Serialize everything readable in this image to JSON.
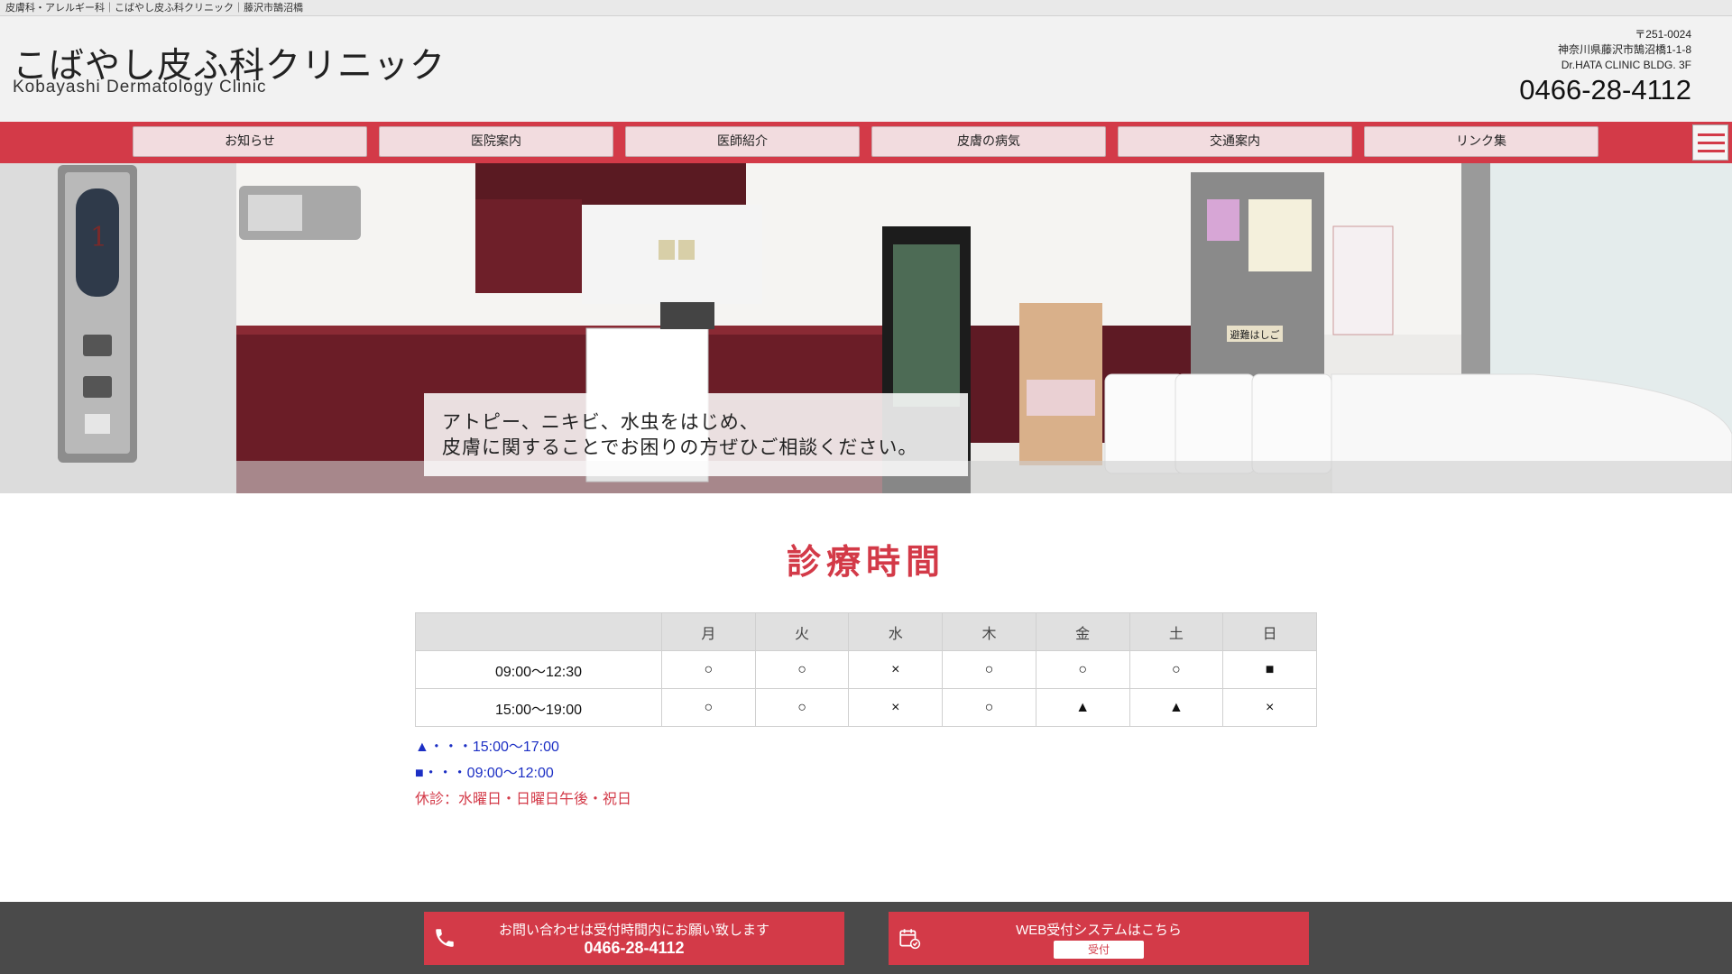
{
  "top_strip": {
    "text": "皮膚科・アレルギー科｜こばやし皮ふ科クリニック｜藤沢市鵠沼橋"
  },
  "header": {
    "logo_jp": "こばやし皮ふ科クリニック",
    "logo_en": "Kobayashi Dermatology Clinic",
    "postal": "〒251-0024",
    "address": "神奈川県藤沢市鵠沼橋1-1-8",
    "building": "Dr.HATA CLINIC BLDG. 3F",
    "tel": "0466-28-4112"
  },
  "nav": {
    "items": [
      "お知らせ",
      "医院案内",
      "医師紹介",
      "皮膚の病気",
      "交通案内",
      "リンク集"
    ],
    "menu_icon": "hamburger-icon"
  },
  "hero": {
    "caption_line1": "アトピー、ニキビ、水虫をはじめ、",
    "caption_line2": "皮膚に関することでお困りの方ぜひご相談ください。",
    "sign_text": "避難はしご"
  },
  "hours": {
    "title": "診療時間",
    "days": [
      "月",
      "火",
      "水",
      "木",
      "金",
      "土",
      "日"
    ],
    "rows": [
      {
        "time": "09:00～12:30",
        "cells": [
          "○",
          "○",
          "×",
          "○",
          "○",
          "○",
          "■"
        ]
      },
      {
        "time": "15:00～19:00",
        "cells": [
          "○",
          "○",
          "×",
          "○",
          "▲",
          "▲",
          "×"
        ]
      }
    ],
    "note_triangle": "▲・・・15:00～17:00",
    "note_square": "■・・・09:00～12:00",
    "note_closed": "休診：水曜日・日曜日午後・祝日"
  },
  "footer": {
    "contact_line1": "お問い合わせは受付時間内にお願い致します",
    "contact_tel": "0466-28-4112",
    "web_line1": "WEB受付システムはこちら",
    "web_button": "受付"
  },
  "colors": {
    "accent": "#d33a48",
    "blue_mark": "#1c2fc4",
    "footer_bg": "#4a4a4a"
  }
}
